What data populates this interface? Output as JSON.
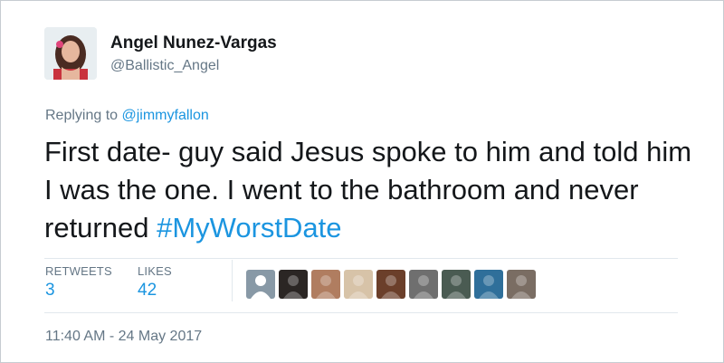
{
  "author": {
    "display_name": "Angel Nunez-Vargas",
    "handle": "@Ballistic_Angel",
    "avatar_icon": "profile-photo-icon"
  },
  "reply": {
    "prefix": "Replying to",
    "mention": "@jimmyfallon"
  },
  "tweet": {
    "text": "First date- guy said Jesus spoke to him and told him I was the one. I went to the bathroom and never returned ",
    "hashtag": "#MyWorstDate"
  },
  "stats": {
    "retweets_label": "RETWEETS",
    "retweets_count": "3",
    "likes_label": "LIKES",
    "likes_count": "42"
  },
  "likers": [
    {
      "icon": "default-avatar-icon",
      "color": "#8899a6"
    },
    {
      "icon": "liker-avatar-icon",
      "color": "#2b2624"
    },
    {
      "icon": "liker-avatar-icon",
      "color": "#b07d60"
    },
    {
      "icon": "liker-avatar-icon",
      "color": "#d7c3a8"
    },
    {
      "icon": "liker-avatar-icon",
      "color": "#6b3f2a"
    },
    {
      "icon": "liker-avatar-icon",
      "color": "#6f6f6f"
    },
    {
      "icon": "liker-avatar-icon",
      "color": "#4a5b52"
    },
    {
      "icon": "liker-avatar-icon",
      "color": "#2f6f9a"
    },
    {
      "icon": "liker-avatar-icon",
      "color": "#7a6d63"
    }
  ],
  "timestamp": "11:40 AM - 24 May 2017",
  "colors": {
    "link": "#1b95e0",
    "text": "#14171a",
    "muted": "#657786"
  }
}
